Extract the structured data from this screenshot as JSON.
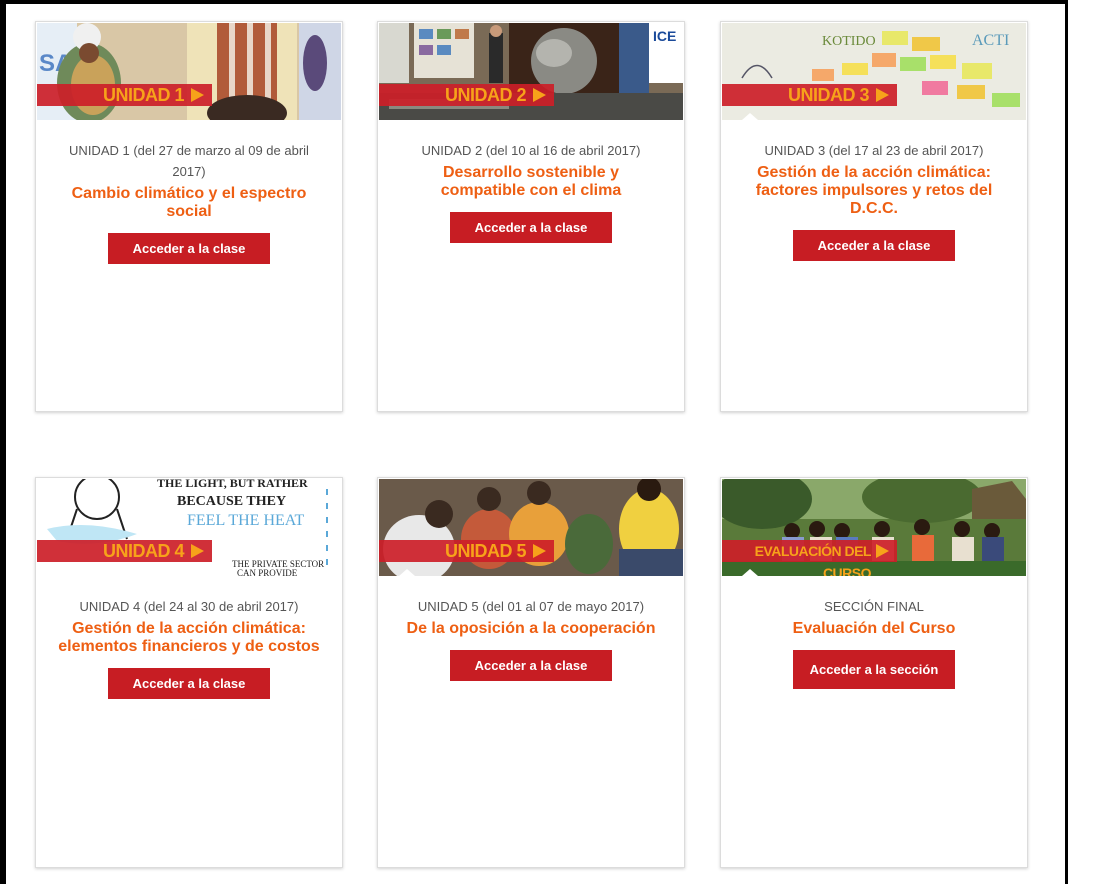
{
  "cards": [
    {
      "banner": "UNIDAD 1",
      "subtitle": "UNIDAD 1 (del 27 de marzo al 09 de abril 2017)",
      "title": "Cambio climático y el espectro social",
      "button": "Acceder a la clase"
    },
    {
      "banner": "UNIDAD 2",
      "subtitle": "UNIDAD 2 (del 10 al 16 de abril 2017)",
      "title": "Desarrollo sostenible y compatible con el clima",
      "button": "Acceder a la clase"
    },
    {
      "banner": "UNIDAD 3",
      "subtitle": "UNIDAD 3 (del 17 al 23 de abril 2017)",
      "title": "Gestión de la acción climática: factores impulsores y retos del D.C.C.",
      "button": "Acceder a la clase"
    },
    {
      "banner": "UNIDAD 4",
      "subtitle": "UNIDAD 4 (del 24 al 30 de abril 2017)",
      "title": "Gestión de la acción climática: elementos financieros y de costos",
      "button": "Acceder a la clase"
    },
    {
      "banner": "UNIDAD 5",
      "subtitle": "UNIDAD 5 (del 01 al 07 de mayo 2017)",
      "title": "De la oposición a la cooperación",
      "button": "Acceder a la clase"
    },
    {
      "banner": "EVALUACIÓN DEL CURSO",
      "subtitle": "SECCIÓN FINAL",
      "title": "Evaluación del Curso",
      "button": "Acceder a la sección"
    }
  ],
  "colors": {
    "accent_orange": "#ee5f13",
    "button_red": "#c71d23",
    "banner_text": "#f7a21a"
  }
}
